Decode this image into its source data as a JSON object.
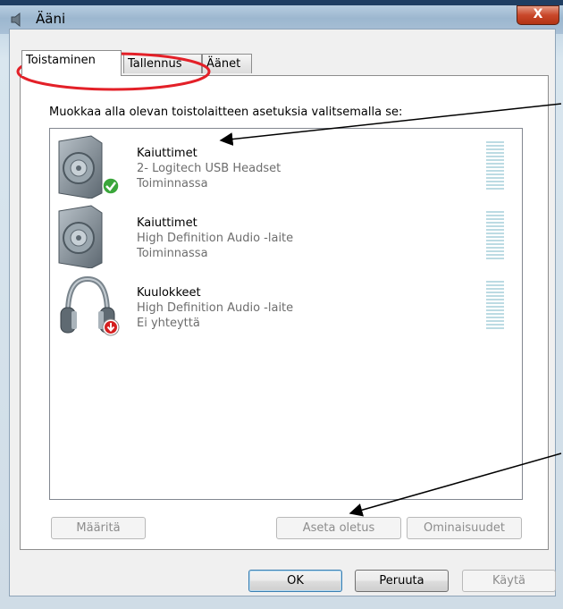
{
  "window": {
    "title": "Ääni",
    "close_label": "X"
  },
  "tabs": [
    {
      "label": "Toistaminen",
      "active": true
    },
    {
      "label": "Tallennus",
      "active": false
    },
    {
      "label": "Äänet",
      "active": false
    }
  ],
  "instruction": "Muokkaa alla olevan toistolaitteen asetuksia valitsemalla se:",
  "devices": [
    {
      "name": "Kaiuttimet",
      "description": "2- Logitech USB Headset",
      "status": "Toiminnassa",
      "icon": "speaker-icon",
      "badge": "default-check-badge"
    },
    {
      "name": "Kaiuttimet",
      "description": "High Definition Audio -laite",
      "status": "Toiminnassa",
      "icon": "speaker-icon",
      "badge": ""
    },
    {
      "name": "Kuulokkeet",
      "description": "High Definition Audio -laite",
      "status": "Ei yhteyttä",
      "icon": "headphones-icon",
      "badge": "unplugged-badge"
    }
  ],
  "buttons": {
    "configure": "Määritä",
    "set_default": "Aseta oletus",
    "properties": "Ominaisuudet",
    "ok": "OK",
    "cancel": "Peruuta",
    "apply": "Käytä"
  },
  "colors": {
    "annotation_circle": "#e32028",
    "annotation_arrow": "#000000",
    "close_button": "#c9472a",
    "default_check": "#3aa63a",
    "unplugged_badge": "#d42020"
  }
}
